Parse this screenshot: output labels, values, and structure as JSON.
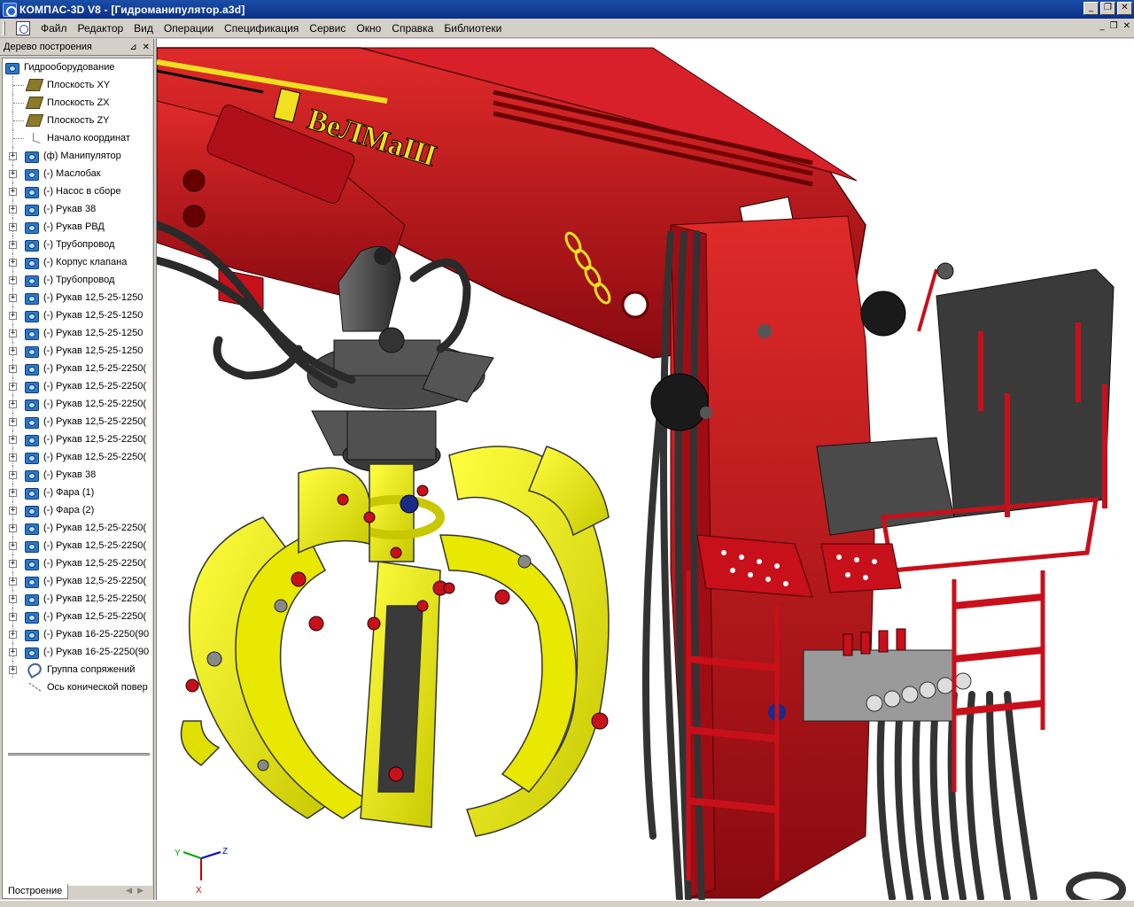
{
  "window": {
    "title": "КОМПАС-3D V8 - [Гидроманипулятор.a3d]",
    "buttons": [
      "_",
      "❐",
      "✕"
    ]
  },
  "menu": {
    "items": [
      "Файл",
      "Редактор",
      "Вид",
      "Операции",
      "Спецификация",
      "Сервис",
      "Окно",
      "Справка",
      "Библиотеки"
    ],
    "mdi_buttons": [
      "_",
      "❐",
      "✕"
    ]
  },
  "panel": {
    "title": "Дерево построения",
    "pin": "⊿",
    "close": "✕",
    "tab": "Построение"
  },
  "tree": {
    "root": "Гидрооборудование",
    "planes": [
      "Плоскость XY",
      "Плоскость ZX",
      "Плоскость ZY"
    ],
    "origin": "Начало координат",
    "parts": [
      "(ф) Манипулятор",
      "(-) Маслобак",
      "(-) Насос в сборе",
      "(-) Рукав 38",
      "(-) Рукав РВД",
      "(-) Трубопровод",
      "(-) Корпус клапана",
      "(-) Трубопровод",
      "(-) Рукав 12,5-25-1250",
      "(-) Рукав 12,5-25-1250",
      "(-) Рукав 12,5-25-1250",
      "(-) Рукав 12,5-25-1250",
      "(-) Рукав 12,5-25-2250(",
      "(-) Рукав 12,5-25-2250(",
      "(-) Рукав 12,5-25-2250(",
      "(-) Рукав 12,5-25-2250(",
      "(-) Рукав 12,5-25-2250(",
      "(-) Рукав 12,5-25-2250(",
      "(-) Рукав 38",
      "(-) Фара (1)",
      "(-) Фара (2)",
      "(-) Рукав 12,5-25-2250(",
      "(-) Рукав 12,5-25-2250(",
      "(-) Рукав 12,5-25-2250(",
      "(-) Рукав 12,5-25-2250(",
      "(-) Рукав 12,5-25-2250(",
      "(-) Рукав 12,5-25-2250(",
      "(-) Рукав 16-25-2250(90",
      "(-) Рукав 16-25-2250(90"
    ],
    "mates": "Группа сопряжений",
    "axis": "Ось конической повер"
  },
  "viewport": {
    "brand": "ВеЛМаШ",
    "axes": {
      "x": "X",
      "y": "Y",
      "z": "Z"
    },
    "colors": {
      "boom": "#c8101a",
      "grapple": "#f0f000",
      "hose": "#3a3a3a",
      "seat": "#404040"
    }
  }
}
